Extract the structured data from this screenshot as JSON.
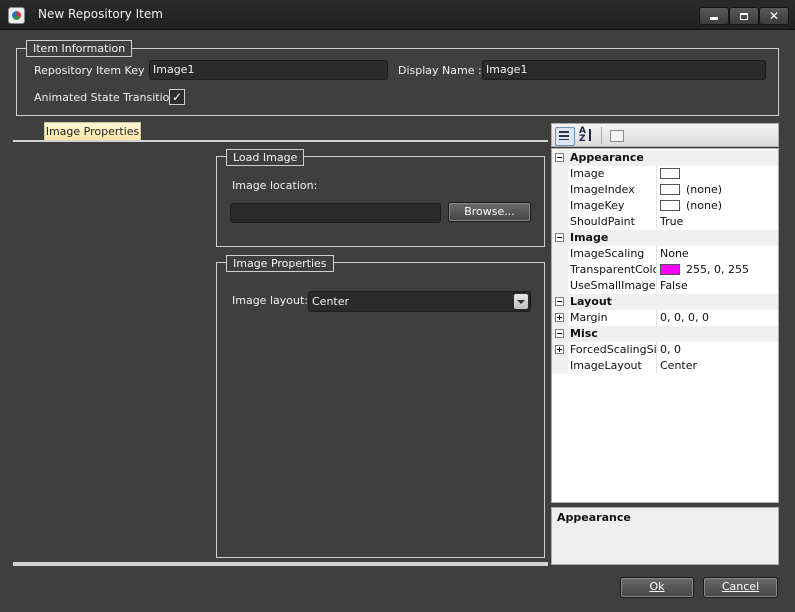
{
  "window": {
    "title": "New Repository Item"
  },
  "item_info": {
    "legend": "Item Information",
    "key_label": "Repository Item Key :",
    "key_value": "Image1",
    "display_name_label": "Display Name :",
    "display_name_value": "Image1",
    "animated_label": "Animated State Transition",
    "animated_checked": true,
    "check_glyph": "✓"
  },
  "tabs": [
    {
      "label": "Image Properties"
    }
  ],
  "load_image": {
    "legend": "Load Image",
    "location_label": "Image location:",
    "location_value": "",
    "browse_label": "Browse..."
  },
  "image_properties": {
    "legend": "Image Properties",
    "layout_label": "Image layout:",
    "layout_value": "Center"
  },
  "property_grid": {
    "categories": [
      {
        "name": "Appearance",
        "rows": [
          {
            "name": "Image",
            "value": "",
            "swatch": "#ffffff"
          },
          {
            "name": "ImageIndex",
            "value": "(none)",
            "swatch": "#ffffff"
          },
          {
            "name": "ImageKey",
            "value": "(none)",
            "swatch": "#ffffff"
          },
          {
            "name": "ShouldPaint",
            "value": "True"
          }
        ]
      },
      {
        "name": "Image",
        "rows": [
          {
            "name": "ImageScaling",
            "value": "None"
          },
          {
            "name": "TransparentColor",
            "value": "255, 0, 255",
            "swatch": "#ff00ff"
          },
          {
            "name": "UseSmallImageLis",
            "value": "False"
          }
        ]
      },
      {
        "name": "Layout",
        "rows": [
          {
            "name": "Margin",
            "value": "0, 0, 0, 0",
            "expandable": true
          }
        ]
      },
      {
        "name": "Misc",
        "rows": [
          {
            "name": "ForcedScalingSize",
            "value": "0, 0",
            "expandable": true
          },
          {
            "name": "ImageLayout",
            "value": "Center"
          }
        ]
      }
    ],
    "help_title": "Appearance"
  },
  "buttons": {
    "ok": "Ok",
    "cancel": "Cancel"
  },
  "colors": {
    "background": "#3f3f3f",
    "tab_active": "#fbe6a6",
    "transparent_color": "#ff00ff"
  }
}
